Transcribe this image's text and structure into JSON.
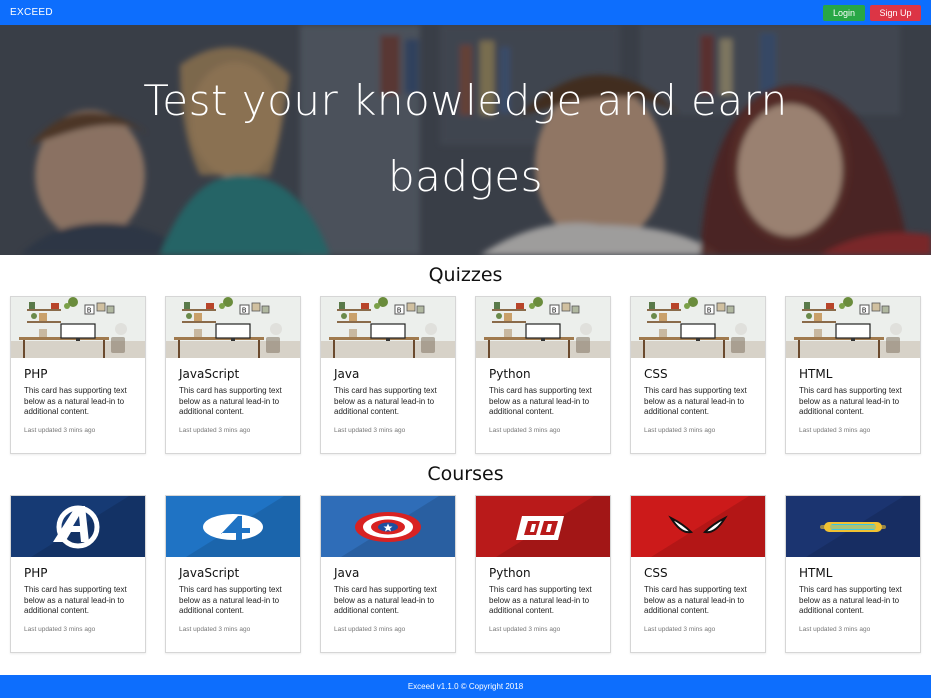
{
  "navbar": {
    "brand": "EXCEED",
    "login_label": "Login",
    "signup_label": "Sign Up"
  },
  "hero": {
    "title": "Test your knowledge and earn badges"
  },
  "quizzes": {
    "heading": "Quizzes",
    "cards": [
      {
        "title": "PHP",
        "text": "This card has supporting text below as a natural lead-in to additional content.",
        "updated": "Last updated 3 mins ago"
      },
      {
        "title": "JavaScript",
        "text": "This card has supporting text below as a natural lead-in to additional content.",
        "updated": "Last updated 3 mins ago"
      },
      {
        "title": "Java",
        "text": "This card has supporting text below as a natural lead-in to additional content.",
        "updated": "Last updated 3 mins ago"
      },
      {
        "title": "Python",
        "text": "This card has supporting text below as a natural lead-in to additional content.",
        "updated": "Last updated 3 mins ago"
      },
      {
        "title": "CSS",
        "text": "This card has supporting text below as a natural lead-in to additional content.",
        "updated": "Last updated 3 mins ago"
      },
      {
        "title": "HTML",
        "text": "This card has supporting text below as a natural lead-in to additional content.",
        "updated": "Last updated 3 mins ago"
      }
    ]
  },
  "courses": {
    "heading": "Courses",
    "cards": [
      {
        "title": "PHP",
        "text": "This card has supporting text below as a natural lead-in to additional content.",
        "updated": "Last updated 3 mins ago",
        "icon": "avengers-logo-icon",
        "bg": "#163a74"
      },
      {
        "title": "JavaScript",
        "text": "This card has supporting text below as a natural lead-in to additional content.",
        "updated": "Last updated 3 mins ago",
        "icon": "fantastic-four-logo-icon",
        "bg": "#1f73c4"
      },
      {
        "title": "Java",
        "text": "This card has supporting text below as a natural lead-in to additional content.",
        "updated": "Last updated 3 mins ago",
        "icon": "captain-america-shield-icon",
        "bg": "#2f6db8"
      },
      {
        "title": "Python",
        "text": "This card has supporting text below as a natural lead-in to additional content.",
        "updated": "Last updated 3 mins ago",
        "icon": "daredevil-logo-icon",
        "bg": "#b91a1a"
      },
      {
        "title": "CSS",
        "text": "This card has supporting text below as a natural lead-in to additional content.",
        "updated": "Last updated 3 mins ago",
        "icon": "spiderman-mask-icon",
        "bg": "#cc1a1a"
      },
      {
        "title": "HTML",
        "text": "This card has supporting text below as a natural lead-in to additional content.",
        "updated": "Last updated 3 mins ago",
        "icon": "cyclops-visor-icon",
        "bg": "#1b3470"
      }
    ]
  },
  "footer": {
    "text": "Exceed v1.1.0 © Copyright 2018"
  },
  "colors": {
    "primary": "#0d6efd",
    "login": "#28a745",
    "signup": "#dc3545"
  }
}
